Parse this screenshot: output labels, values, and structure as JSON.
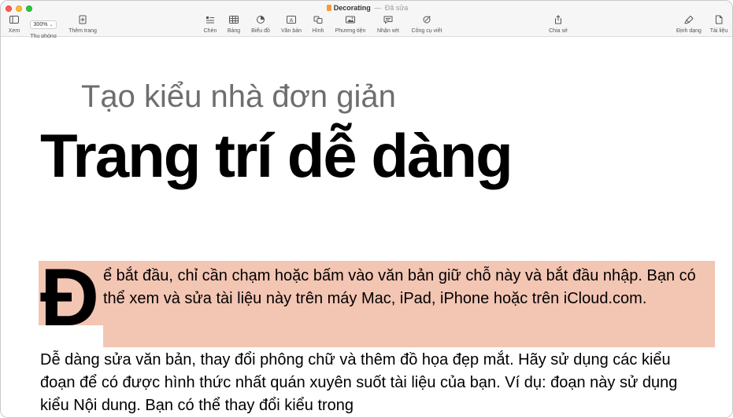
{
  "window": {
    "title": "Decorating",
    "separator": "—",
    "status": "Đã sửa"
  },
  "toolbar": {
    "left": [
      {
        "label": "Xem",
        "icon": "sidebar-icon"
      },
      {
        "label": "Thu phóng",
        "icon": "zoom-menu",
        "value": "300%"
      },
      {
        "label": "Thêm trang",
        "icon": "add-page-icon"
      }
    ],
    "center": [
      {
        "label": "Chèn",
        "icon": "insert-icon"
      },
      {
        "label": "Bảng",
        "icon": "table-icon"
      },
      {
        "label": "Biểu đồ",
        "icon": "chart-icon"
      },
      {
        "label": "Văn bản",
        "icon": "text-box-icon"
      },
      {
        "label": "Hình",
        "icon": "shape-icon"
      },
      {
        "label": "Phương tiện",
        "icon": "media-icon"
      },
      {
        "label": "Nhận xét",
        "icon": "comment-icon"
      },
      {
        "label": "Công cụ viết",
        "icon": "writing-tools-icon"
      }
    ],
    "share": {
      "label": "Chia sẻ",
      "icon": "share-icon"
    },
    "right": [
      {
        "label": "Định dạng",
        "icon": "format-brush-icon"
      },
      {
        "label": "Tài liệu",
        "icon": "document-icon"
      }
    ]
  },
  "document": {
    "subtitle": "Tạo kiểu nhà đơn giản",
    "title": "Trang trí dễ dàng",
    "dropcap": "Đ",
    "paragraph1": "ể bắt đầu, chỉ cần chạm hoặc bấm vào văn bản giữ chỗ này và bắt đầu nhập. Bạn có thể xem và sửa tài liệu này trên máy Mac, iPad, iPhone hoặc trên iCloud.com.",
    "paragraph2": "Dễ dàng sửa văn bản, thay đổi phông chữ và thêm đồ họa đẹp mắt. Hãy sử dụng các kiểu đoạn để có được hình thức nhất quán xuyên suốt tài liệu của bạn. Ví dụ: đoạn này sử dụng kiểu Nội dung. Bạn có thể thay đổi kiểu trong",
    "selection_color": "#f3c5b3"
  }
}
